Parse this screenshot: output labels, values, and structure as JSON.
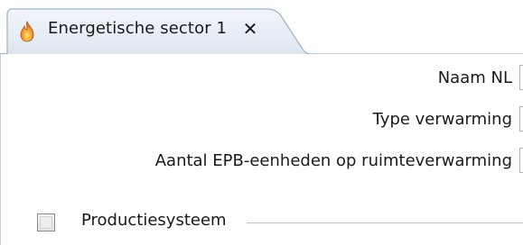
{
  "tab": {
    "title": "Energetische sector 1",
    "close_glyph": "✕",
    "icon": "flame-icon",
    "accent": "#f0a22e"
  },
  "form": {
    "fields": [
      {
        "label": "Naam NL",
        "value": ""
      },
      {
        "label": "Type verwarming",
        "value": ""
      },
      {
        "label": "Aantal EPB-eenheden op ruimteverwarming",
        "value": ""
      }
    ],
    "group": {
      "label": "Productiesysteem",
      "checked": false
    }
  },
  "colors": {
    "tab_fill_top": "#eef3f9",
    "tab_fill_bottom": "#dfe8f3",
    "tab_border": "#9fb2c8"
  }
}
